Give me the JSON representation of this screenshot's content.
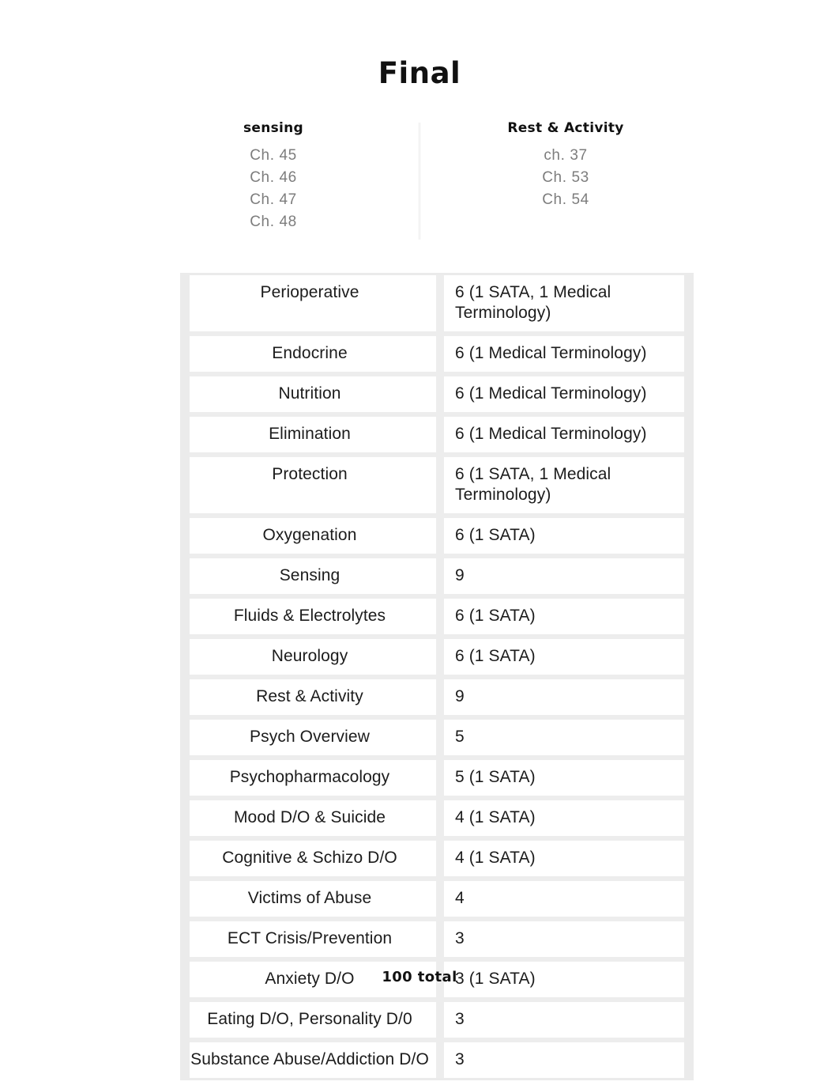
{
  "title": "Final",
  "chapter_columns": [
    {
      "heading": "sensing",
      "items": [
        "Ch. 45",
        "Ch. 46",
        "Ch. 47",
        "Ch. 48"
      ]
    },
    {
      "heading": "Rest & Activity",
      "items": [
        "ch. 37",
        "Ch. 53",
        "Ch. 54"
      ]
    }
  ],
  "table": {
    "rows": [
      {
        "topic": "Perioperative",
        "count": "6 (1 SATA, 1 Medical Terminology)"
      },
      {
        "topic": "Endocrine",
        "count": "6 (1 Medical Terminology)"
      },
      {
        "topic": "Nutrition",
        "count": "6 (1 Medical Terminology)"
      },
      {
        "topic": "Elimination",
        "count": "6 (1 Medical Terminology)"
      },
      {
        "topic": "Protection",
        "count": "6 (1 SATA, 1 Medical Terminology)"
      },
      {
        "topic": "Oxygenation",
        "count": "6 (1 SATA)"
      },
      {
        "topic": "Sensing",
        "count": "9"
      },
      {
        "topic": "Fluids & Electrolytes",
        "count": "6 (1 SATA)"
      },
      {
        "topic": "Neurology",
        "count": "6 (1 SATA)"
      },
      {
        "topic": "Rest & Activity",
        "count": "9"
      },
      {
        "topic": "Psych Overview",
        "count": "5"
      },
      {
        "topic": "Psychopharmacology",
        "count": "5 (1 SATA)"
      },
      {
        "topic": "Mood D/O & Suicide",
        "count": "4 (1 SATA)"
      },
      {
        "topic": "Cognitive & Schizo D/O",
        "count": "4 (1 SATA)"
      },
      {
        "topic": "Victims of Abuse",
        "count": "4"
      },
      {
        "topic": "ECT Crisis/Prevention",
        "count": "3"
      },
      {
        "topic": "Anxiety D/O",
        "count": "3 (1 SATA)"
      },
      {
        "topic": "Eating D/O, Personality D/0",
        "count": "3"
      },
      {
        "topic": "Substance Abuse/Addiction D/O",
        "count": "3"
      }
    ]
  },
  "footer": {
    "total": "100 total"
  },
  "colors": {
    "text": "#1c1c1c",
    "muted_text": "#7d7d7d",
    "row_divider": "#ededed",
    "table_gutter": "#ebebeb"
  }
}
